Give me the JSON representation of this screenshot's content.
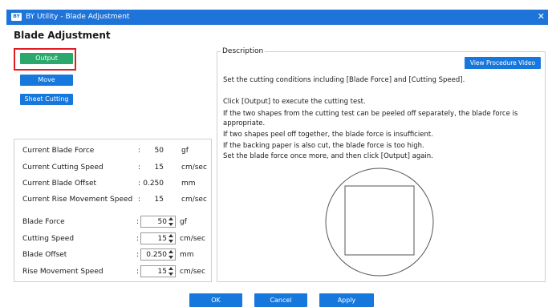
{
  "window": {
    "title": "BY Utility - Blade Adjustment",
    "icon_text": "BY"
  },
  "heading": "Blade Adjustment",
  "buttons": {
    "output": "Output",
    "move": "Move",
    "sheet_cutting": "Sheet Cutting",
    "view_video": "View Procedure Video",
    "ok": "OK",
    "cancel": "Cancel",
    "apply": "Apply"
  },
  "current": [
    {
      "label": "Current Blade Force",
      "value": "50",
      "unit": "gf"
    },
    {
      "label": "Current Cutting Speed",
      "value": "15",
      "unit": "cm/sec"
    },
    {
      "label": "Current Blade Offset",
      "value": "0.250",
      "unit": "mm"
    },
    {
      "label": "Current Rise Movement Speed",
      "value": "15",
      "unit": "cm/sec"
    }
  ],
  "settings": [
    {
      "label": "Blade Force",
      "value": "50",
      "unit": "gf"
    },
    {
      "label": "Cutting Speed",
      "value": "15",
      "unit": "cm/sec"
    },
    {
      "label": "Blade Offset",
      "value": "0.250",
      "unit": "mm"
    },
    {
      "label": "Rise Movement Speed",
      "value": "15",
      "unit": "cm/sec"
    }
  ],
  "description": {
    "title": "Description",
    "lines": [
      "Set the cutting conditions including [Blade Force] and [Cutting Speed].",
      "Click [Output] to execute the cutting test.",
      "If the two shapes from the cutting test can be peeled off separately, the blade force is",
      "appropriate.",
      "If two shapes peel off together, the blade force is insufficient.",
      "If the backing paper is also cut, the blade force is too high.",
      "Set the blade force once more, and then click [Output] again."
    ]
  },
  "colors": {
    "titlebar": "#1e74d8",
    "button_blue": "#1677dd",
    "output_green": "#2ba86b",
    "highlight_red": "#e01c24"
  }
}
